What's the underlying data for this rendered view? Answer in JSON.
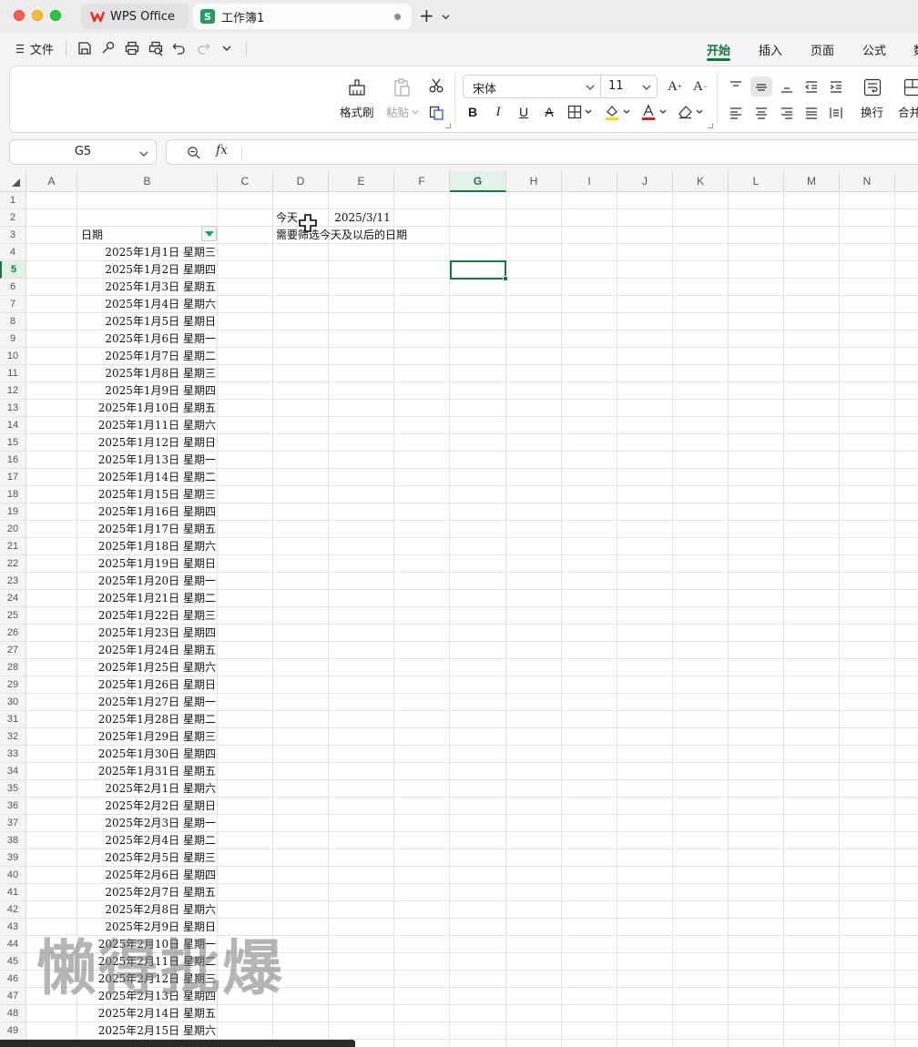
{
  "titlebar": {
    "tabs": [
      {
        "label": "WPS Office"
      },
      {
        "label": "工作簿1"
      }
    ]
  },
  "menubar": {
    "file_label": "文件",
    "ribbon_tabs": [
      "开始",
      "插入",
      "页面",
      "公式",
      "数"
    ]
  },
  "ribbon": {
    "format_painter": "格式刷",
    "paste": "粘贴",
    "font_name": "宋体",
    "font_size": "11",
    "wrap": "换行",
    "merge": "合并"
  },
  "formula": {
    "name_box": "G5",
    "fx": "fx",
    "content": ""
  },
  "sheet": {
    "columns": [
      "A",
      "B",
      "C",
      "D",
      "E",
      "F",
      "G",
      "H",
      "I",
      "J",
      "K",
      "L",
      "M",
      "N"
    ],
    "selected_column": "G",
    "selected_row": 5,
    "d2": "今天",
    "e2": "2025/3/11",
    "b3": "日期",
    "d3": "需要筛选今天及以后的日期",
    "dates": [
      "2025年1月1日  星期三",
      "2025年1月2日  星期四",
      "2025年1月3日  星期五",
      "2025年1月4日  星期六",
      "2025年1月5日  星期日",
      "2025年1月6日  星期一",
      "2025年1月7日  星期二",
      "2025年1月8日  星期三",
      "2025年1月9日  星期四",
      "2025年1月10日  星期五",
      "2025年1月11日  星期六",
      "2025年1月12日  星期日",
      "2025年1月13日  星期一",
      "2025年1月14日  星期二",
      "2025年1月15日  星期三",
      "2025年1月16日  星期四",
      "2025年1月17日  星期五",
      "2025年1月18日  星期六",
      "2025年1月19日  星期日",
      "2025年1月20日  星期一",
      "2025年1月21日  星期二",
      "2025年1月22日  星期三",
      "2025年1月23日  星期四",
      "2025年1月24日  星期五",
      "2025年1月25日  星期六",
      "2025年1月26日  星期日",
      "2025年1月27日  星期一",
      "2025年1月28日  星期二",
      "2025年1月29日  星期三",
      "2025年1月30日  星期四",
      "2025年1月31日  星期五",
      "2025年2月1日  星期六",
      "2025年2月2日  星期日",
      "2025年2月3日  星期一",
      "2025年2月4日  星期二",
      "2025年2月5日  星期三",
      "2025年2月6日  星期四",
      "2025年2月7日  星期五",
      "2025年2月8日  星期六",
      "2025年2月9日  星期日",
      "2025年2月10日  星期一",
      "2025年2月11日  星期二",
      "2025年2月12日  星期三",
      "2025年2月13日  星期四",
      "2025年2月14日  星期五",
      "2025年2月15日  星期六"
    ]
  },
  "watermark": "懒得批爆",
  "colors": {
    "accent": "#0f7b3f",
    "sheet_icon": "#1e9d5c",
    "wps_red": "#e8332a"
  }
}
